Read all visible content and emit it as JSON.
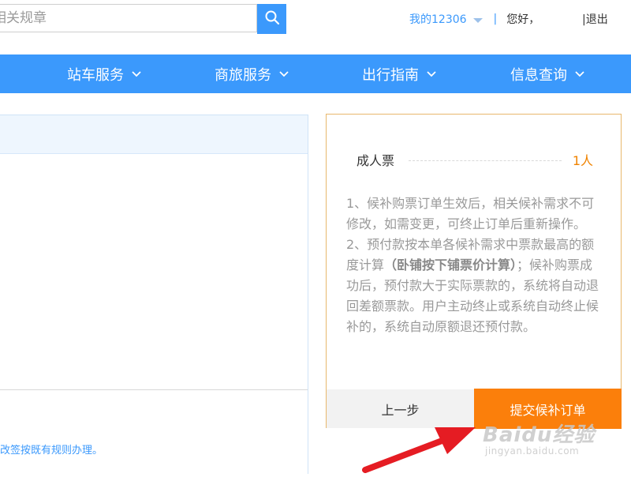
{
  "header": {
    "search_placeholder": "相关规章",
    "my_account": "我的12306",
    "separator": "|",
    "greeting": "您好，",
    "logout_sep": "|",
    "logout": "退出"
  },
  "nav": {
    "items": [
      {
        "label": "站车服务"
      },
      {
        "label": "商旅服务"
      },
      {
        "label": "出行指南"
      },
      {
        "label": "信息查询"
      }
    ]
  },
  "left": {
    "note": "改签按既有规则办理。"
  },
  "summary": {
    "ticket_type": "成人票",
    "ticket_count": "1人",
    "rule1": "1、候补购票订单生效后，相关候补需求不可修改，如需变更，可终止订单后重新操作。",
    "rule2_pre": "2、预付款按本单各候补需求中票款最高的额度计算",
    "rule2_bold": "（卧铺按下铺票价计算）",
    "rule2_post": "；候补购票成功后，预付款大于实际票款的，系统将自动退回差额票款。用户主动终止或系统自动终止候补的，系统自动原额退还预付款。",
    "prev_button": "上一步",
    "submit_button": "提交候补订单"
  },
  "watermark": {
    "logo": "Baidu经验",
    "url": "jingyan.baidu.com"
  },
  "colors": {
    "primary": "#3b99fc",
    "accent": "#fb7f0b",
    "count": "#f08300",
    "annotation_arrow": "#e51c23"
  }
}
